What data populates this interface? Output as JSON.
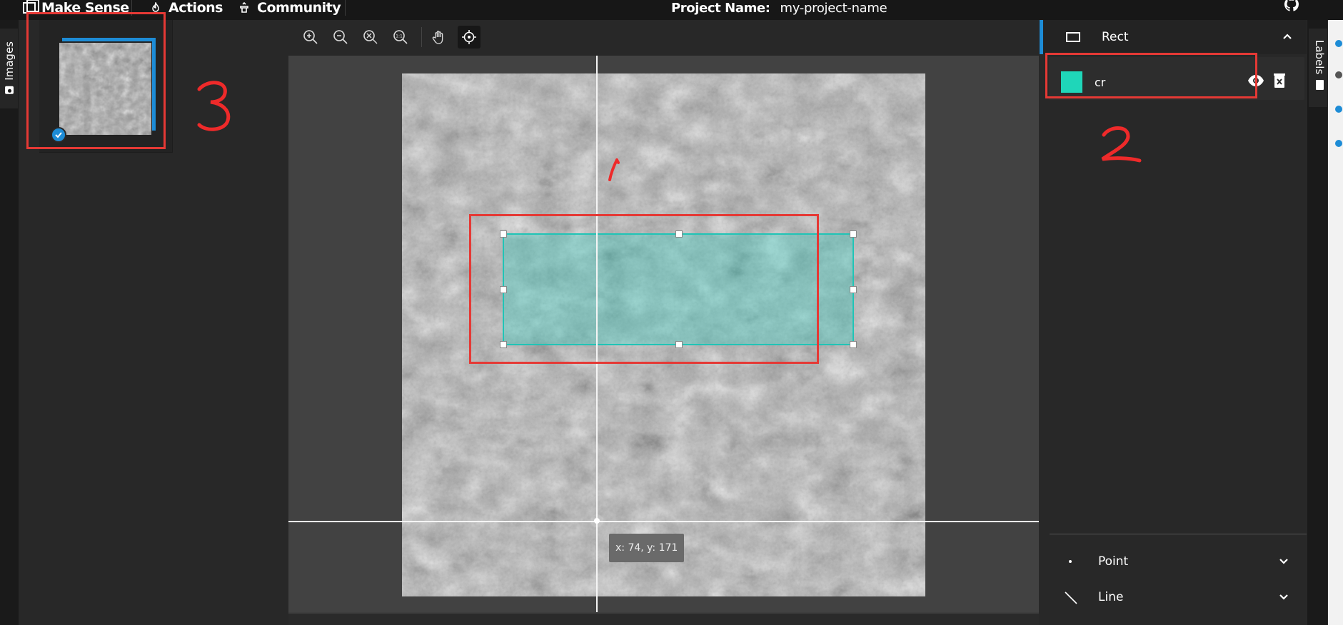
{
  "topbar": {
    "brand": "Make Sense",
    "nav": [
      "Actions",
      "Community"
    ],
    "project_label": "Project Name:",
    "project_name": "my-project-name"
  },
  "left_tab": {
    "label": "Images"
  },
  "right_tab": {
    "label": "Labels"
  },
  "canvas": {
    "cursor_readout": "x: 74, y: 171"
  },
  "labels_panel": {
    "active_tool": "Rect",
    "labels": [
      {
        "name": "cr",
        "color": "#1fd6b9"
      }
    ],
    "other_tools": [
      "Point",
      "Line"
    ]
  },
  "colors": {
    "accent": "#1d8cd6",
    "label": "#1fd6b9",
    "highlight": "#e53935"
  },
  "annotations": [
    "1",
    "2",
    "3"
  ]
}
